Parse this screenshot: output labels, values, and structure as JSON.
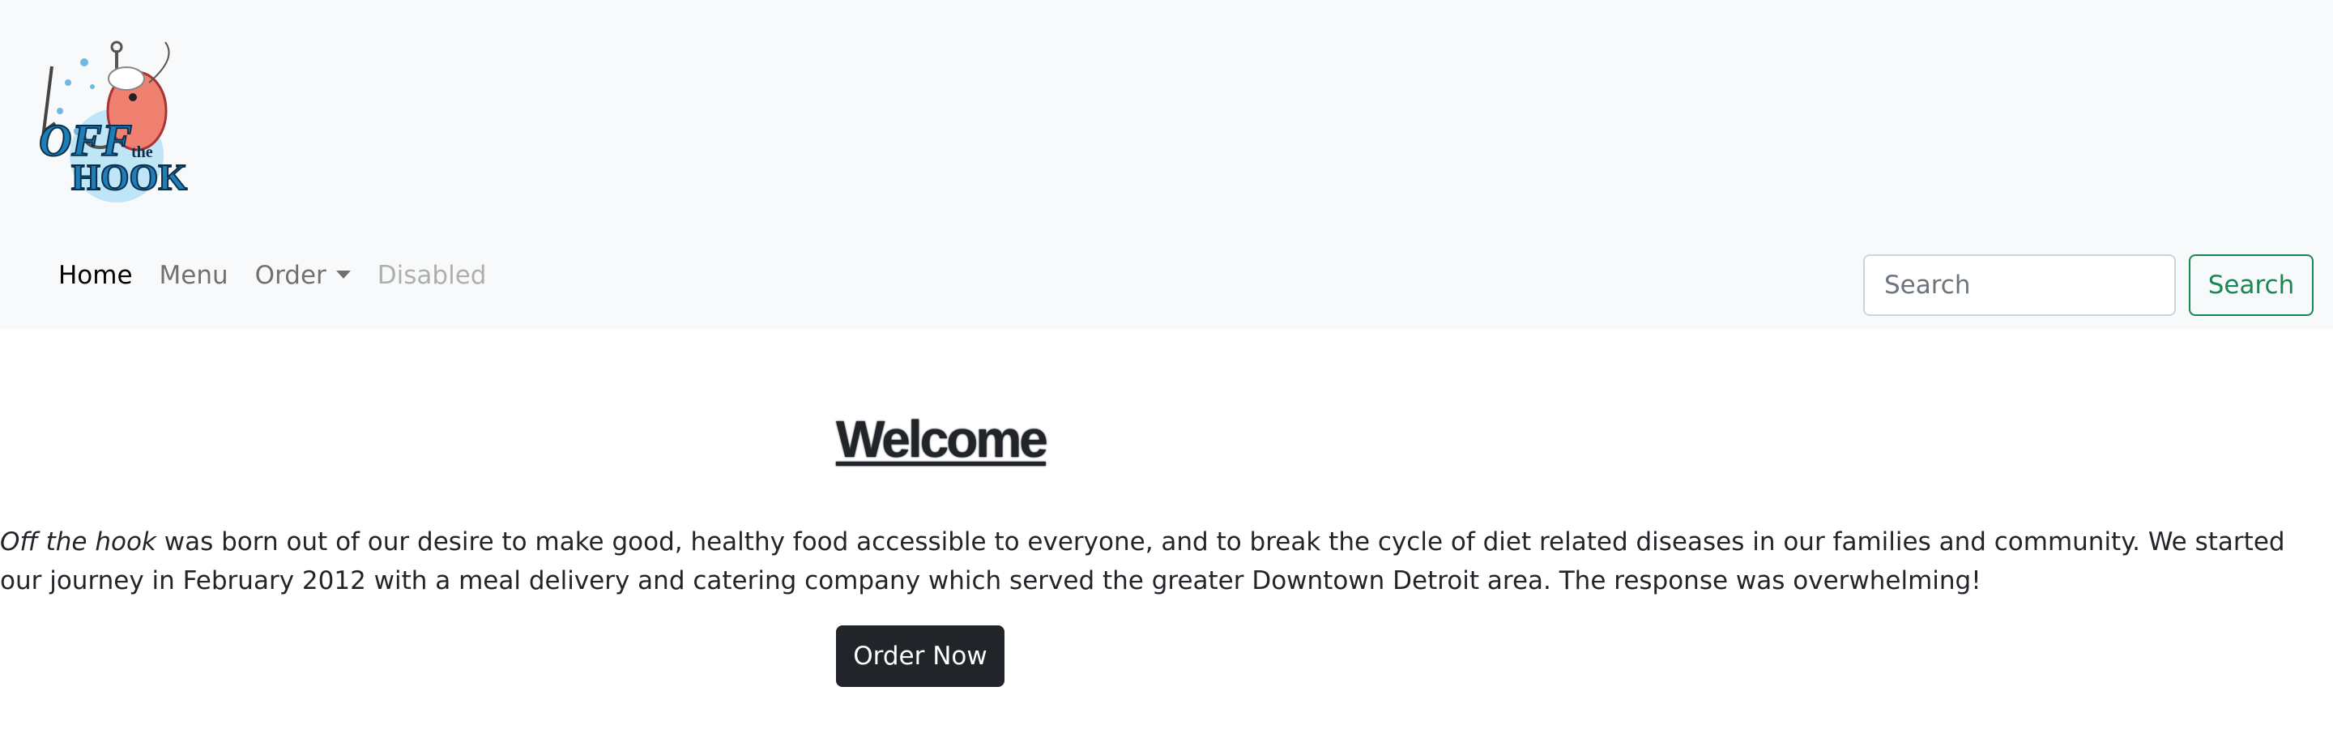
{
  "brand": {
    "logo_text_line1": "OFF",
    "logo_text_small": "the",
    "logo_text_line2": "HOOK"
  },
  "nav": {
    "home": "Home",
    "menu": "Menu",
    "order": "Order",
    "disabled": "Disabled"
  },
  "search": {
    "placeholder": "Search",
    "button_label": "Search"
  },
  "main": {
    "heading": "Welcome",
    "intro_brand": "Off the hook",
    "intro_text": " was born out of our desire to make good, healthy food accessible to everyone, and to break the cycle of diet related diseases in our families and community. We started our journey in February 2012 with a meal delivery and catering company which served the greater Downtown Detroit area. The response was overwhelming!",
    "order_button": "Order Now"
  },
  "colors": {
    "navbar_bg": "#f8f9fa",
    "success": "#198754",
    "dark": "#212529"
  }
}
